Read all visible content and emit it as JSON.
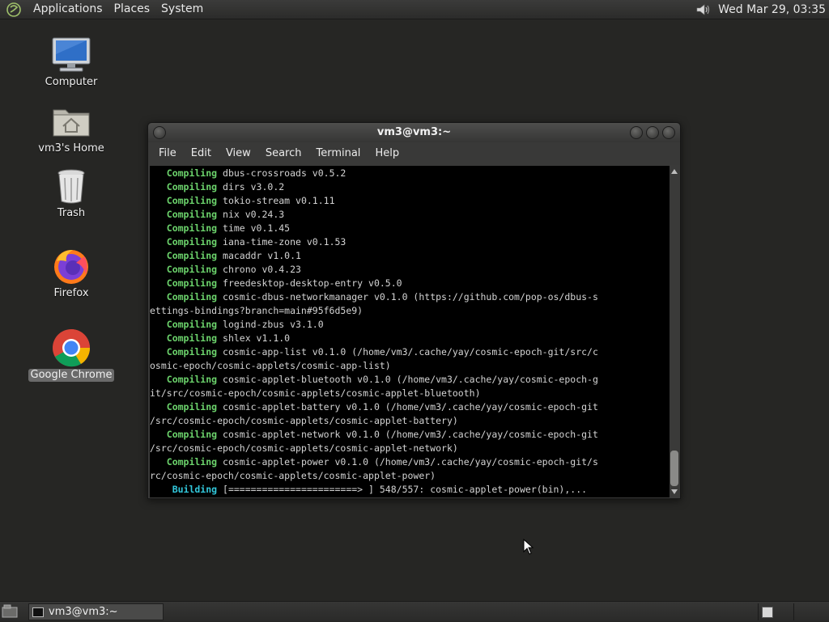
{
  "top_panel": {
    "menus": [
      "Applications",
      "Places",
      "System"
    ],
    "clock": "Wed Mar 29, 03:35"
  },
  "desktop_icons": [
    {
      "label": "Computer",
      "icon": "computer-icon"
    },
    {
      "label": "vm3's Home",
      "icon": "home-folder-icon"
    },
    {
      "label": "Trash",
      "icon": "trash-icon"
    },
    {
      "label": "Firefox",
      "icon": "firefox-icon"
    },
    {
      "label": "Google Chrome",
      "icon": "chrome-icon",
      "selected": true
    }
  ],
  "window": {
    "title": "vm3@vm3:~",
    "menus": [
      "File",
      "Edit",
      "View",
      "Search",
      "Terminal",
      "Help"
    ]
  },
  "terminal_lines": [
    {
      "kw": "   Compiling",
      "rest": " dbus-crossroads v0.5.2"
    },
    {
      "kw": "   Compiling",
      "rest": " dirs v3.0.2"
    },
    {
      "kw": "   Compiling",
      "rest": " tokio-stream v0.1.11"
    },
    {
      "kw": "   Compiling",
      "rest": " nix v0.24.3"
    },
    {
      "kw": "   Compiling",
      "rest": " time v0.1.45"
    },
    {
      "kw": "   Compiling",
      "rest": " iana-time-zone v0.1.53"
    },
    {
      "kw": "   Compiling",
      "rest": " macaddr v1.0.1"
    },
    {
      "kw": "   Compiling",
      "rest": " chrono v0.4.23"
    },
    {
      "kw": "   Compiling",
      "rest": " freedesktop-desktop-entry v0.5.0"
    },
    {
      "kw": "   Compiling",
      "rest": " cosmic-dbus-networkmanager v0.1.0 (https://github.com/pop-os/dbus-s"
    },
    {
      "kw": "",
      "rest": "ettings-bindings?branch=main#95f6d5e9)"
    },
    {
      "kw": "   Compiling",
      "rest": " logind-zbus v3.1.0"
    },
    {
      "kw": "   Compiling",
      "rest": " shlex v1.1.0"
    },
    {
      "kw": "   Compiling",
      "rest": " cosmic-app-list v0.1.0 (/home/vm3/.cache/yay/cosmic-epoch-git/src/c"
    },
    {
      "kw": "",
      "rest": "osmic-epoch/cosmic-applets/cosmic-app-list)"
    },
    {
      "kw": "   Compiling",
      "rest": " cosmic-applet-bluetooth v0.1.0 (/home/vm3/.cache/yay/cosmic-epoch-g"
    },
    {
      "kw": "",
      "rest": "it/src/cosmic-epoch/cosmic-applets/cosmic-applet-bluetooth)"
    },
    {
      "kw": "   Compiling",
      "rest": " cosmic-applet-battery v0.1.0 (/home/vm3/.cache/yay/cosmic-epoch-git"
    },
    {
      "kw": "",
      "rest": "/src/cosmic-epoch/cosmic-applets/cosmic-applet-battery)"
    },
    {
      "kw": "   Compiling",
      "rest": " cosmic-applet-network v0.1.0 (/home/vm3/.cache/yay/cosmic-epoch-git"
    },
    {
      "kw": "",
      "rest": "/src/cosmic-epoch/cosmic-applets/cosmic-applet-network)"
    },
    {
      "kw": "   Compiling",
      "rest": " cosmic-applet-power v0.1.0 (/home/vm3/.cache/yay/cosmic-epoch-git/s"
    },
    {
      "kw": "",
      "rest": "rc/cosmic-epoch/cosmic-applets/cosmic-applet-power)"
    },
    {
      "kw": "    Building",
      "rest": " [=======================> ] 548/557: cosmic-applet-power(bin),...",
      "building": true
    }
  ],
  "taskbar": {
    "window_label": "vm3@vm3:~"
  },
  "colors": {
    "compiling": "#6cd36c",
    "building": "#32c8dc"
  }
}
